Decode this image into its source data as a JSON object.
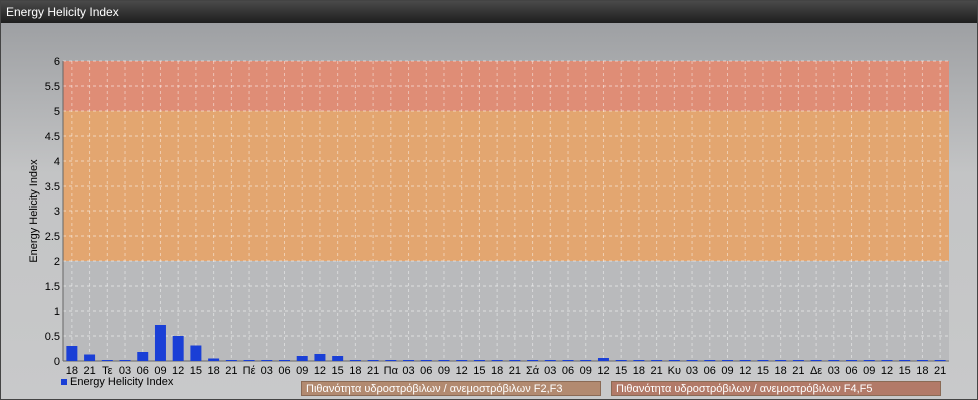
{
  "window": {
    "title": "Energy Helicity Index"
  },
  "chart_data": {
    "type": "bar",
    "ylabel": "Energy Helicity Index",
    "ylim": [
      0,
      6
    ],
    "yticks": [
      "0",
      "0.5",
      "1",
      "1.5",
      "2",
      "2.5",
      "3",
      "3.5",
      "4",
      "4.5",
      "5",
      "5.5",
      "6"
    ],
    "categories": [
      "18",
      "21",
      "Τε",
      "03",
      "06",
      "09",
      "12",
      "15",
      "18",
      "21",
      "Πέ",
      "03",
      "06",
      "09",
      "12",
      "15",
      "18",
      "21",
      "Πα",
      "03",
      "06",
      "09",
      "12",
      "15",
      "18",
      "21",
      "Σά",
      "03",
      "06",
      "09",
      "12",
      "15",
      "18",
      "21",
      "Κυ",
      "03",
      "06",
      "09",
      "12",
      "15",
      "18",
      "21",
      "Δε",
      "03",
      "06",
      "09",
      "12",
      "15",
      "18",
      "21"
    ],
    "series": [
      {
        "name": "Energy Helicity Index",
        "color": "#1a3fd6",
        "values": [
          0.3,
          0.13,
          0.02,
          0.02,
          0.18,
          0.72,
          0.5,
          0.31,
          0.05,
          0.02,
          0.01,
          0.01,
          0.01,
          0.1,
          0.14,
          0.1,
          0.02,
          0.02,
          0.01,
          0.01,
          0.02,
          0.01,
          0.01,
          0.01,
          0.01,
          0.01,
          0.01,
          0.01,
          0.01,
          0.01,
          0.06,
          0.01,
          0.01,
          0.01,
          0.01,
          0.01,
          0.01,
          0.01,
          0.01,
          0.01,
          0.01,
          0.01,
          0.01,
          0.01,
          0.01,
          0.01,
          0.01,
          0.01,
          0.01,
          0.01
        ]
      }
    ],
    "bands": [
      {
        "from": 2,
        "to": 5,
        "color": "#e5a46c",
        "label": "Πιθανότητα υδροστρόβιλων / ανεμοστρόβιλων F2,F3"
      },
      {
        "from": 5,
        "to": 6,
        "color": "#e08a72",
        "label": "Πιθανότητα υδροστρόβιλων / ανεμοστρόβιλων F4,F5"
      }
    ],
    "grid": true,
    "legend": "bottom-left"
  }
}
